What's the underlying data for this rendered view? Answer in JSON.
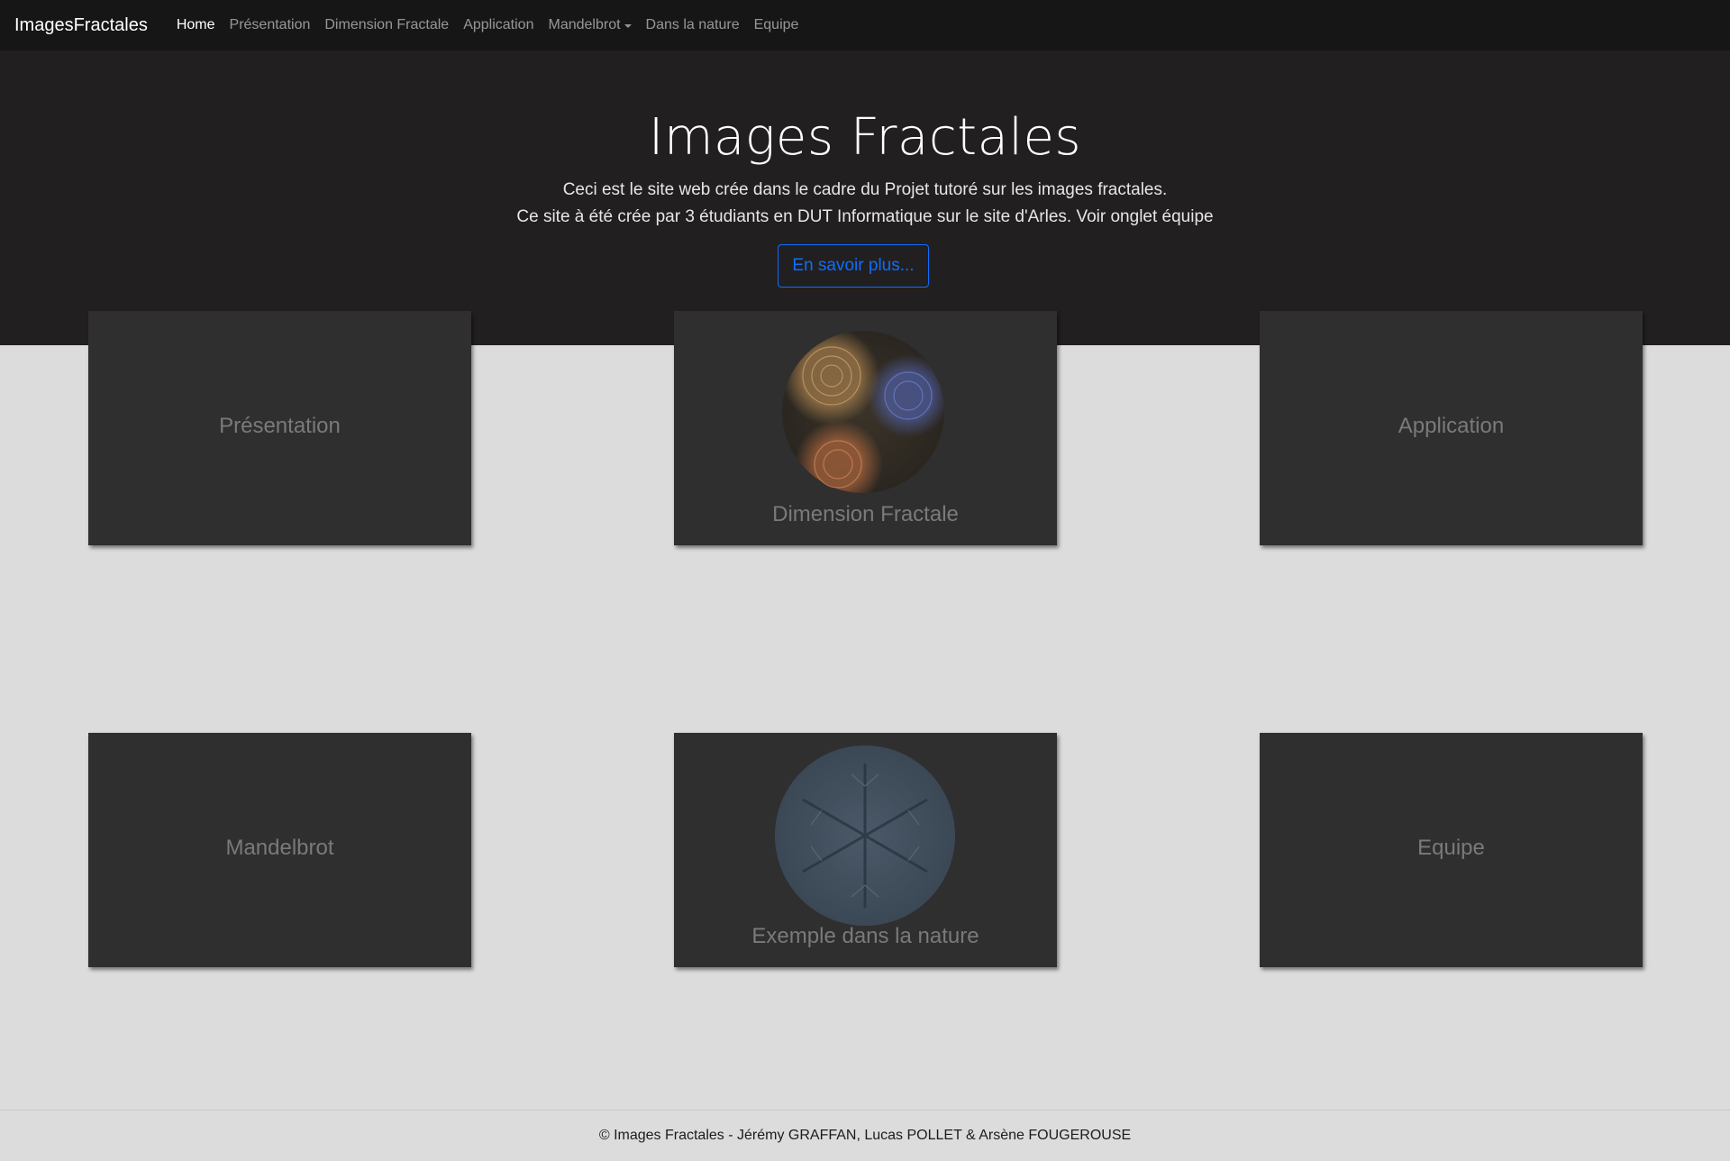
{
  "navbar": {
    "brand": "ImagesFractales",
    "items": [
      {
        "label": "Home"
      },
      {
        "label": "Présentation"
      },
      {
        "label": "Dimension Fractale"
      },
      {
        "label": "Application"
      },
      {
        "label": "Mandelbrot"
      },
      {
        "label": "Dans la nature"
      },
      {
        "label": "Equipe"
      }
    ]
  },
  "hero": {
    "title": "Images Fractales",
    "line1": "Ceci est le site web crée dans le cadre du Projet tutoré sur les images fractales.",
    "line2": "Ce site à été crée par 3 étudiants en DUT Informatique sur le site d'Arles. Voir onglet équipe",
    "button": "En savoir plus..."
  },
  "cards": [
    {
      "label": "Présentation"
    },
    {
      "label": "Dimension Fractale"
    },
    {
      "label": "Application"
    },
    {
      "label": "Mandelbrot"
    },
    {
      "label": "Exemple dans la nature"
    },
    {
      "label": "Equipe"
    }
  ],
  "footer": {
    "text": "© Images Fractales - Jérémy GRAFFAN, Lucas POLLET & Arsène FOUGEROUSE"
  },
  "colors": {
    "navbar_bg": "#161616",
    "hero_bg": "#221f20",
    "page_bg": "#dcdcdc",
    "card_bg": "#2f2f2f",
    "button_accent": "#0d6efd"
  }
}
